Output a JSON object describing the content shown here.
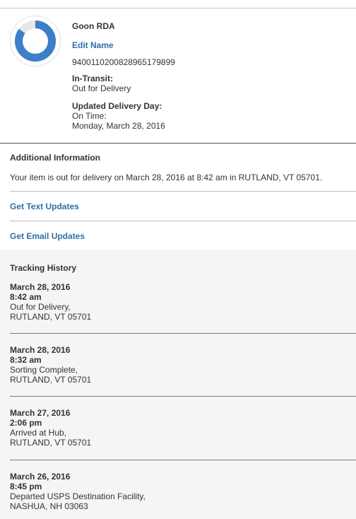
{
  "summary": {
    "nickname": "Goon RDA",
    "edit_name_label": "Edit Name",
    "tracking_number": "9400110200828965179899",
    "status_title": "In-Transit:",
    "status_text": "Out for Delivery",
    "delivery_title": "Updated Delivery Day:",
    "delivery_status": "On Time:",
    "delivery_date": "Monday, March 28, 2016",
    "progress_fraction": 0.85,
    "progress_color": "#3a7fc8",
    "progress_track_color": "#e6e6e6"
  },
  "additional": {
    "title": "Additional Information",
    "text": "Your item is out for delivery on March 28, 2016 at 8:42 am in RUTLAND, VT 05701."
  },
  "links": {
    "text_updates": "Get Text Updates",
    "email_updates": "Get Email Updates"
  },
  "history": {
    "title": "Tracking History",
    "events": [
      {
        "date": "March 28, 2016",
        "time": "8:42 am",
        "desc": "Out for Delivery,",
        "loc": "RUTLAND, VT 05701"
      },
      {
        "date": "March 28, 2016",
        "time": "8:32 am",
        "desc": "Sorting Complete,",
        "loc": "RUTLAND, VT 05701"
      },
      {
        "date": "March 27, 2016",
        "time": "2:06 pm",
        "desc": "Arrived at Hub,",
        "loc": "RUTLAND, VT 05701"
      },
      {
        "date": "March 26, 2016",
        "time": "8:45 pm",
        "desc": "Departed USPS Destination Facility,",
        "loc": "NASHUA, NH 03063"
      }
    ]
  }
}
